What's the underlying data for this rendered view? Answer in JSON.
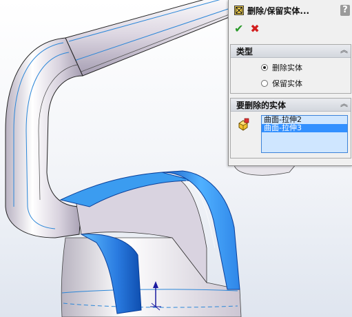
{
  "panel": {
    "title": "删除/保留实体...",
    "help": "?",
    "ok_icon": "check-icon",
    "cancel_icon": "close-icon",
    "type_section": {
      "title": "类型",
      "collapse_glyph": "︽",
      "options": [
        {
          "label": "删除实体",
          "selected": true
        },
        {
          "label": "保留实体",
          "selected": false
        }
      ]
    },
    "bodies_section": {
      "title": "要删除的实体",
      "collapse_glyph": "︽",
      "items": [
        {
          "label": "曲面-拉伸2",
          "selected": false
        },
        {
          "label": "曲面-拉伸3",
          "selected": true
        }
      ]
    }
  },
  "colors": {
    "surface_blue": "#3b9cf0",
    "body_gray": "#e2dde6",
    "accent_select": "#3390ff"
  }
}
